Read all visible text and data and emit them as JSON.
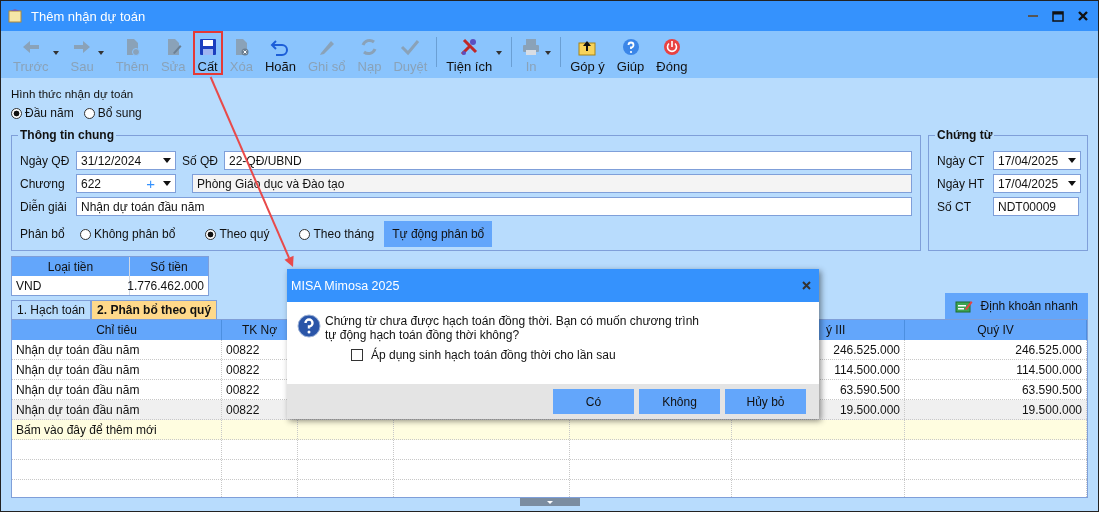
{
  "window": {
    "title": "Thêm nhận dự toán"
  },
  "toolbar": [
    {
      "label": "Trước",
      "disabled": true,
      "has_menu": true,
      "highlighted": false
    },
    {
      "label": "Sau",
      "disabled": true,
      "has_menu": true,
      "highlighted": false
    },
    {
      "label": "Thêm",
      "disabled": true,
      "has_menu": false,
      "highlighted": false
    },
    {
      "label": "Sửa",
      "disabled": true,
      "has_menu": false,
      "highlighted": false
    },
    {
      "label": "Cất",
      "disabled": false,
      "has_menu": false,
      "highlighted": true
    },
    {
      "label": "Xóa",
      "disabled": true,
      "has_menu": false,
      "highlighted": false
    },
    {
      "label": "Hoãn",
      "disabled": false,
      "has_menu": false,
      "highlighted": false
    },
    {
      "label": "Ghi sổ",
      "disabled": true,
      "has_menu": false,
      "highlighted": false
    },
    {
      "label": "Nạp",
      "disabled": true,
      "has_menu": false,
      "highlighted": false
    },
    {
      "label": "Duyệt",
      "disabled": true,
      "has_menu": false,
      "highlighted": false
    },
    {
      "label": "Tiện ích",
      "disabled": false,
      "has_menu": true,
      "highlighted": false
    },
    {
      "label": "In",
      "disabled": true,
      "has_menu": true,
      "highlighted": false
    },
    {
      "label": "Góp ý",
      "disabled": false,
      "has_menu": false,
      "highlighted": false
    },
    {
      "label": "Giúp",
      "disabled": false,
      "has_menu": false,
      "highlighted": false
    },
    {
      "label": "Đóng",
      "disabled": false,
      "has_menu": false,
      "highlighted": false
    }
  ],
  "receive_type": {
    "label": "Hình thức nhận dự toán",
    "options": [
      {
        "label": "Đầu năm",
        "selected": true
      },
      {
        "label": "Bổ sung",
        "selected": false
      }
    ]
  },
  "general_info": {
    "title": "Thông tin chung",
    "ngay_qd": {
      "label": "Ngày QĐ",
      "value": "31/12/2024"
    },
    "so_qd": {
      "label": "Số QĐ",
      "value": "22-QĐ/UBND"
    },
    "chuong": {
      "label": "Chương",
      "value": "622",
      "add_symbol": "+"
    },
    "chuong_name": {
      "value": "Phòng Giáo dục và Đào tạo"
    },
    "dien_giai": {
      "label": "Diễn giải",
      "value": "Nhận dự toán đầu năm"
    },
    "allocation": {
      "label": "Phân bổ",
      "options": [
        {
          "label": "Không phân bổ",
          "selected": false
        },
        {
          "label": "Theo quý",
          "selected": true
        },
        {
          "label": "Theo tháng",
          "selected": false
        }
      ]
    },
    "auto_button": "Tự động phân bổ"
  },
  "voucher": {
    "title": "Chứng từ",
    "ngay_ct": {
      "label": "Ngày CT",
      "value": "17/04/2025"
    },
    "ngay_ht": {
      "label": "Ngày HT",
      "value": "17/04/2025"
    },
    "so_ct": {
      "label": "Số CT",
      "value": "NDT00009"
    }
  },
  "currency_table": {
    "columns": [
      "Loại tiền",
      "Số tiền"
    ],
    "rows": [
      [
        "VND",
        "1.776.462.000"
      ]
    ]
  },
  "tabs": [
    {
      "label": "1. Hạch toán",
      "selected": false
    },
    {
      "label": "2. Phân bổ theo quý",
      "selected": true
    }
  ],
  "quick_entry_button": "Định khoản nhanh",
  "grid": {
    "columns": {
      "chi_tieu": "Chỉ tiêu",
      "tk_no": "TK Nợ",
      "quy_iii": "ý III",
      "quy_iv": "Quý IV"
    },
    "rows": [
      {
        "chi_tieu": "Nhận dự toán đầu năm",
        "tk_no": "00822",
        "quy_iii": "246.525.000",
        "quy_iv": "246.525.000",
        "selected": false
      },
      {
        "chi_tieu": "Nhận dự toán đầu năm",
        "tk_no": "00822",
        "quy_iii": "114.500.000",
        "quy_iv": "114.500.000",
        "selected": false
      },
      {
        "chi_tieu": "Nhận dự toán đầu năm",
        "tk_no": "00822",
        "quy_iii": "63.590.500",
        "quy_iv": "63.590.500",
        "selected": false
      },
      {
        "chi_tieu": "Nhận dự toán đầu năm",
        "tk_no": "00822",
        "quy_iii": "19.500.000",
        "quy_iv": "19.500.000",
        "selected": true
      }
    ],
    "new_row_hint": "Bấm vào đây để thêm mới"
  },
  "dialog": {
    "title": "MISA Mimosa 2025",
    "message": "Chứng từ chưa được hạch toán đồng thời. Bạn có muốn chương trình tự động hạch toán đồng thời không?",
    "checkbox": {
      "label": "Áp dụng sinh hạch toán đồng thời cho lần sau",
      "checked": false
    },
    "buttons": [
      "Có",
      "Không",
      "Hủy bỏ"
    ]
  }
}
